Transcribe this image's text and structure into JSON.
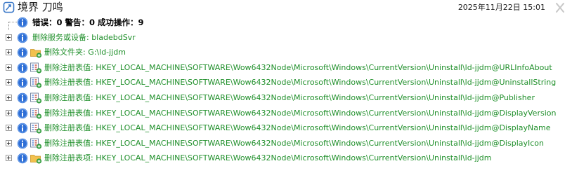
{
  "window": {
    "title": "境界 刀鸣",
    "datetime": "2025年11月22日 15:01",
    "close_icon": "close-icon"
  },
  "colors": {
    "summary_text": "#000000",
    "item_text": "#1f8f2a",
    "info_icon": "#2f6fd6"
  },
  "tree": {
    "summary": {
      "text": "错误：0  警告：0  成功操作：9",
      "icon": "info-icon"
    },
    "items": [
      {
        "text": "删除服务或设备: bladebdSvr",
        "icon": "info-icon",
        "type_icon": "none"
      },
      {
        "text": "删除文件夹:  G:\\ld-jjdm",
        "icon": "info-icon",
        "type_icon": "folder-icon"
      },
      {
        "text": "删除注册表值:  HKEY_LOCAL_MACHINE\\SOFTWARE\\Wow6432Node\\Microsoft\\Windows\\CurrentVersion\\Uninstall\\ld-jjdm@URLInfoAbout",
        "icon": "info-icon",
        "type_icon": "registry-value-icon"
      },
      {
        "text": "删除注册表值:  HKEY_LOCAL_MACHINE\\SOFTWARE\\Wow6432Node\\Microsoft\\Windows\\CurrentVersion\\Uninstall\\ld-jjdm@UninstallString",
        "icon": "info-icon",
        "type_icon": "registry-value-icon"
      },
      {
        "text": "删除注册表值:  HKEY_LOCAL_MACHINE\\SOFTWARE\\Wow6432Node\\Microsoft\\Windows\\CurrentVersion\\Uninstall\\ld-jjdm@Publisher",
        "icon": "info-icon",
        "type_icon": "registry-value-icon"
      },
      {
        "text": "删除注册表值:  HKEY_LOCAL_MACHINE\\SOFTWARE\\Wow6432Node\\Microsoft\\Windows\\CurrentVersion\\Uninstall\\ld-jjdm@DisplayVersion",
        "icon": "info-icon",
        "type_icon": "registry-value-icon"
      },
      {
        "text": "删除注册表值:  HKEY_LOCAL_MACHINE\\SOFTWARE\\Wow6432Node\\Microsoft\\Windows\\CurrentVersion\\Uninstall\\ld-jjdm@DisplayName",
        "icon": "info-icon",
        "type_icon": "registry-value-icon"
      },
      {
        "text": "删除注册表值:  HKEY_LOCAL_MACHINE\\SOFTWARE\\Wow6432Node\\Microsoft\\Windows\\CurrentVersion\\Uninstall\\ld-jjdm@DisplayIcon",
        "icon": "info-icon",
        "type_icon": "registry-value-icon"
      },
      {
        "text": "删除注册表项:  HKEY_LOCAL_MACHINE\\SOFTWARE\\Wow6432Node\\Microsoft\\Windows\\CurrentVersion\\Uninstall\\ld-jjdm",
        "icon": "info-icon",
        "type_icon": "registry-key-icon"
      }
    ]
  }
}
